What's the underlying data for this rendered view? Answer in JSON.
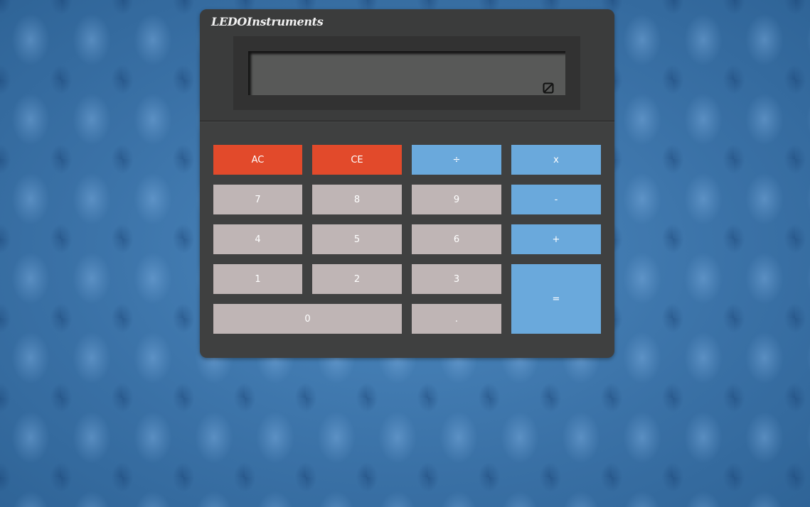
{
  "brand": "LEDOInstruments",
  "display": {
    "value": "",
    "icon": "solar-cell-icon"
  },
  "buttons": {
    "ac": "AC",
    "ce": "CE",
    "divide": "÷",
    "multiply": "x",
    "seven": "7",
    "eight": "8",
    "nine": "9",
    "subtract": "-",
    "four": "4",
    "five": "5",
    "six": "6",
    "add": "+",
    "one": "1",
    "two": "2",
    "three": "3",
    "equals": "=",
    "zero": "0",
    "decimal": "."
  },
  "colors": {
    "clear_keys": "#e24a2b",
    "operator_keys": "#6aa9dc",
    "digit_keys": "#bfb5b5",
    "body": "#3f4040"
  }
}
